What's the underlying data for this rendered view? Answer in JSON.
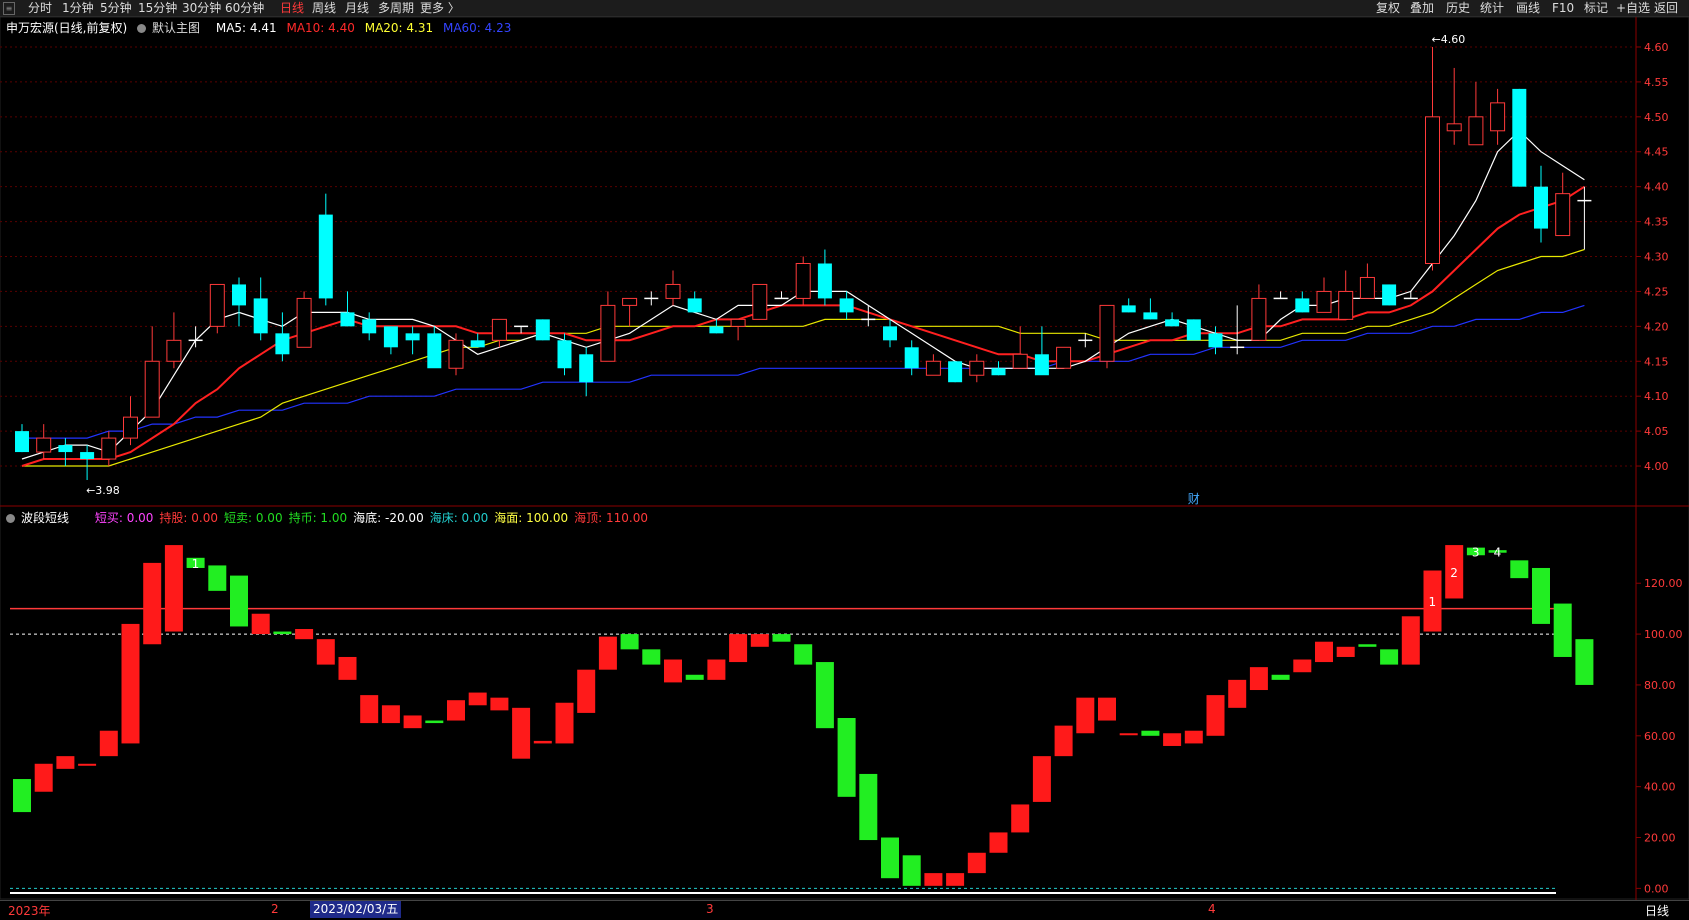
{
  "toolbar": {
    "left": [
      "分时",
      "1分钟",
      "5分钟",
      "15分钟",
      "30分钟",
      "60分钟",
      "日线",
      "周线",
      "月线",
      "多周期",
      "更多 〉"
    ],
    "active": "日线",
    "right": [
      "复权",
      "叠加",
      "历史",
      "统计",
      "画线",
      "F10",
      "标记",
      "+自选",
      "返回"
    ]
  },
  "main_legend": {
    "name": "申万宏源(日线,前复权)",
    "template": "默认主图",
    "ma5": "MA5: 4.41",
    "ma10": "MA10: 4.40",
    "ma20": "MA20: 4.31",
    "ma60": "MA60: 4.23"
  },
  "sub_legend": {
    "name": "波段短线",
    "items": [
      {
        "text": "短买: 0.00",
        "color": "#ff44ff"
      },
      {
        "text": "持股: 0.00",
        "color": "#ff3a3a"
      },
      {
        "text": "短卖: 0.00",
        "color": "#22dd22"
      },
      {
        "text": "持币: 1.00",
        "color": "#22dd22"
      },
      {
        "text": "海底: -20.00",
        "color": "#ffffff"
      },
      {
        "text": "海床: 0.00",
        "color": "#22cccc"
      },
      {
        "text": "海面: 100.00",
        "color": "#ffff44"
      },
      {
        "text": "海顶: 110.00",
        "color": "#ff3a3a"
      }
    ]
  },
  "bottom": {
    "year_label": "2023年",
    "m2": "2",
    "selected_date": "2023/02/03/五",
    "m3": "3",
    "m4": "4",
    "period_tag": "日线"
  },
  "colors": {
    "up": "#ff3a3a",
    "down": "#00ffff",
    "ma5": "#ffffff",
    "ma10": "#ff2020",
    "ma20": "#e8e800",
    "ma60": "#2233ff",
    "wave_up": "#ff1a1a",
    "wave_down": "#22ee22"
  },
  "chart_data": [
    {
      "type": "candlestick",
      "title": "申万宏源(日线,前复权)",
      "y_ticks": [
        4.0,
        4.05,
        4.1,
        4.15,
        4.2,
        4.25,
        4.3,
        4.35,
        4.4,
        4.45,
        4.5,
        4.55,
        4.6
      ],
      "ylim": [
        3.98,
        4.61
      ],
      "annotations": [
        {
          "text": "←3.98",
          "value": 3.98,
          "index": 3
        },
        {
          "text": "←4.60",
          "value": 4.6,
          "index": 65
        }
      ],
      "marker": {
        "text": "财",
        "index": 54
      },
      "ohlc": [
        [
          4.05,
          4.06,
          4.02,
          4.02
        ],
        [
          4.02,
          4.06,
          4.01,
          4.04
        ],
        [
          4.03,
          4.04,
          4.0,
          4.02
        ],
        [
          4.02,
          4.03,
          3.98,
          4.01
        ],
        [
          4.01,
          4.05,
          4.0,
          4.04
        ],
        [
          4.04,
          4.1,
          4.03,
          4.07
        ],
        [
          4.07,
          4.2,
          4.07,
          4.15
        ],
        [
          4.15,
          4.22,
          4.14,
          4.18
        ],
        [
          4.18,
          4.2,
          4.17,
          4.18
        ],
        [
          4.2,
          4.26,
          4.19,
          4.26
        ],
        [
          4.26,
          4.27,
          4.2,
          4.23
        ],
        [
          4.24,
          4.27,
          4.18,
          4.19
        ],
        [
          4.19,
          4.22,
          4.15,
          4.16
        ],
        [
          4.17,
          4.25,
          4.17,
          4.24
        ],
        [
          4.36,
          4.39,
          4.23,
          4.24
        ],
        [
          4.22,
          4.25,
          4.2,
          4.2
        ],
        [
          4.21,
          4.22,
          4.18,
          4.19
        ],
        [
          4.2,
          4.2,
          4.16,
          4.17
        ],
        [
          4.19,
          4.2,
          4.16,
          4.18
        ],
        [
          4.19,
          4.2,
          4.15,
          4.14
        ],
        [
          4.14,
          4.19,
          4.13,
          4.18
        ],
        [
          4.18,
          4.19,
          4.17,
          4.17
        ],
        [
          4.18,
          4.2,
          4.17,
          4.21
        ],
        [
          4.2,
          4.2,
          4.19,
          4.2
        ],
        [
          4.21,
          4.21,
          4.18,
          4.18
        ],
        [
          4.18,
          4.19,
          4.13,
          4.14
        ],
        [
          4.16,
          4.17,
          4.1,
          4.12
        ],
        [
          4.15,
          4.25,
          4.15,
          4.23
        ],
        [
          4.23,
          4.24,
          4.2,
          4.24
        ],
        [
          4.24,
          4.25,
          4.23,
          4.24
        ],
        [
          4.24,
          4.28,
          4.23,
          4.26
        ],
        [
          4.24,
          4.25,
          4.22,
          4.22
        ],
        [
          4.2,
          4.21,
          4.19,
          4.19
        ],
        [
          4.2,
          4.2,
          4.18,
          4.21
        ],
        [
          4.21,
          4.26,
          4.21,
          4.26
        ],
        [
          4.24,
          4.25,
          4.24,
          4.24
        ],
        [
          4.24,
          4.3,
          4.23,
          4.29
        ],
        [
          4.29,
          4.31,
          4.23,
          4.24
        ],
        [
          4.24,
          4.25,
          4.21,
          4.22
        ],
        [
          4.21,
          4.23,
          4.2,
          4.21
        ],
        [
          4.2,
          4.21,
          4.17,
          4.18
        ],
        [
          4.17,
          4.18,
          4.13,
          4.14
        ],
        [
          4.13,
          4.16,
          4.13,
          4.15
        ],
        [
          4.15,
          4.15,
          4.12,
          4.12
        ],
        [
          4.13,
          4.16,
          4.12,
          4.15
        ],
        [
          4.14,
          4.15,
          4.13,
          4.13
        ],
        [
          4.14,
          4.2,
          4.14,
          4.16
        ],
        [
          4.16,
          4.2,
          4.14,
          4.13
        ],
        [
          4.14,
          4.17,
          4.14,
          4.17
        ],
        [
          4.18,
          4.19,
          4.17,
          4.18
        ],
        [
          4.15,
          4.23,
          4.14,
          4.23
        ],
        [
          4.23,
          4.24,
          4.22,
          4.22
        ],
        [
          4.22,
          4.24,
          4.21,
          4.21
        ],
        [
          4.21,
          4.22,
          4.2,
          4.2
        ],
        [
          4.21,
          4.21,
          4.18,
          4.18
        ],
        [
          4.19,
          4.2,
          4.16,
          4.17
        ],
        [
          4.17,
          4.23,
          4.16,
          4.17
        ],
        [
          4.18,
          4.26,
          4.18,
          4.24
        ],
        [
          4.24,
          4.25,
          4.24,
          4.24
        ],
        [
          4.24,
          4.25,
          4.22,
          4.22
        ],
        [
          4.22,
          4.27,
          4.22,
          4.25
        ],
        [
          4.21,
          4.28,
          4.21,
          4.25
        ],
        [
          4.24,
          4.29,
          4.24,
          4.27
        ],
        [
          4.26,
          4.26,
          4.23,
          4.23
        ],
        [
          4.24,
          4.25,
          4.24,
          4.24
        ],
        [
          4.29,
          4.6,
          4.28,
          4.5
        ],
        [
          4.48,
          4.57,
          4.46,
          4.49
        ],
        [
          4.46,
          4.55,
          4.46,
          4.5
        ],
        [
          4.48,
          4.54,
          4.46,
          4.52
        ],
        [
          4.54,
          4.54,
          4.4,
          4.4
        ],
        [
          4.4,
          4.43,
          4.32,
          4.34
        ],
        [
          4.33,
          4.42,
          4.33,
          4.39
        ],
        [
          4.38,
          4.4,
          4.31,
          4.38
        ]
      ],
      "ma5": [
        4.01,
        4.02,
        4.03,
        4.03,
        4.02,
        4.05,
        4.08,
        4.13,
        4.18,
        4.21,
        4.22,
        4.21,
        4.2,
        4.22,
        4.22,
        4.22,
        4.21,
        4.21,
        4.21,
        4.2,
        4.18,
        4.16,
        4.17,
        4.18,
        4.19,
        4.18,
        4.17,
        4.18,
        4.19,
        4.21,
        4.23,
        4.22,
        4.21,
        4.23,
        4.23,
        4.23,
        4.25,
        4.25,
        4.25,
        4.23,
        4.21,
        4.19,
        4.17,
        4.15,
        4.14,
        4.14,
        4.14,
        4.14,
        4.14,
        4.15,
        4.17,
        4.19,
        4.2,
        4.21,
        4.2,
        4.19,
        4.18,
        4.18,
        4.21,
        4.23,
        4.23,
        4.24,
        4.24,
        4.24,
        4.25,
        4.29,
        4.33,
        4.38,
        4.45,
        4.48,
        4.45,
        4.43,
        4.41
      ],
      "ma10": [
        4.0,
        4.01,
        4.01,
        4.01,
        4.01,
        4.02,
        4.04,
        4.06,
        4.09,
        4.11,
        4.14,
        4.16,
        4.18,
        4.19,
        4.2,
        4.21,
        4.2,
        4.2,
        4.2,
        4.2,
        4.2,
        4.19,
        4.19,
        4.19,
        4.19,
        4.19,
        4.18,
        4.18,
        4.18,
        4.19,
        4.2,
        4.2,
        4.21,
        4.21,
        4.22,
        4.23,
        4.23,
        4.23,
        4.23,
        4.22,
        4.21,
        4.2,
        4.19,
        4.18,
        4.17,
        4.16,
        4.16,
        4.15,
        4.15,
        4.15,
        4.16,
        4.17,
        4.18,
        4.18,
        4.19,
        4.19,
        4.19,
        4.2,
        4.2,
        4.21,
        4.21,
        4.21,
        4.22,
        4.22,
        4.23,
        4.25,
        4.28,
        4.31,
        4.34,
        4.36,
        4.37,
        4.38,
        4.4
      ],
      "ma20": [
        4.0,
        4.0,
        4.0,
        4.0,
        4.0,
        4.01,
        4.02,
        4.03,
        4.04,
        4.05,
        4.06,
        4.07,
        4.09,
        4.1,
        4.11,
        4.12,
        4.13,
        4.14,
        4.15,
        4.16,
        4.17,
        4.17,
        4.18,
        4.18,
        4.19,
        4.19,
        4.19,
        4.2,
        4.2,
        4.2,
        4.2,
        4.2,
        4.2,
        4.2,
        4.2,
        4.2,
        4.2,
        4.21,
        4.21,
        4.21,
        4.21,
        4.2,
        4.2,
        4.2,
        4.2,
        4.2,
        4.19,
        4.19,
        4.19,
        4.19,
        4.18,
        4.18,
        4.18,
        4.18,
        4.18,
        4.18,
        4.18,
        4.18,
        4.18,
        4.19,
        4.19,
        4.19,
        4.2,
        4.2,
        4.21,
        4.22,
        4.24,
        4.26,
        4.28,
        4.29,
        4.3,
        4.3,
        4.31
      ],
      "ma60": [
        4.04,
        4.04,
        4.04,
        4.04,
        4.05,
        4.05,
        4.06,
        4.06,
        4.07,
        4.07,
        4.08,
        4.08,
        4.08,
        4.09,
        4.09,
        4.09,
        4.1,
        4.1,
        4.1,
        4.1,
        4.11,
        4.11,
        4.11,
        4.11,
        4.12,
        4.12,
        4.12,
        4.12,
        4.12,
        4.13,
        4.13,
        4.13,
        4.13,
        4.13,
        4.14,
        4.14,
        4.14,
        4.14,
        4.14,
        4.14,
        4.14,
        4.14,
        4.14,
        4.14,
        4.14,
        4.14,
        4.14,
        4.14,
        4.15,
        4.15,
        4.15,
        4.15,
        4.16,
        4.16,
        4.16,
        4.17,
        4.17,
        4.17,
        4.17,
        4.18,
        4.18,
        4.18,
        4.19,
        4.19,
        4.19,
        4.2,
        4.2,
        4.21,
        4.21,
        4.21,
        4.22,
        4.22,
        4.23
      ]
    },
    {
      "type": "bar",
      "title": "波段短线",
      "y_ticks": [
        0,
        20,
        40,
        60,
        80,
        100,
        120
      ],
      "ylim": [
        -3,
        137
      ],
      "ref_lines": [
        {
          "value": 110,
          "style": "solid",
          "color": "#ff3a3a"
        },
        {
          "value": 100,
          "style": "dashed",
          "color": "#ffffff"
        },
        {
          "value": 0,
          "style": "dashed",
          "color": "#22cccc"
        }
      ],
      "bars": [
        [
          43,
          30
        ],
        [
          38,
          49
        ],
        [
          47,
          52
        ],
        [
          49,
          49
        ],
        [
          52,
          62
        ],
        [
          57,
          104
        ],
        [
          96,
          128
        ],
        [
          101,
          135
        ],
        [
          130,
          126
        ],
        [
          127,
          117
        ],
        [
          123,
          103
        ],
        [
          100,
          108
        ],
        [
          101,
          100
        ],
        [
          98,
          102
        ],
        [
          88,
          98
        ],
        [
          82,
          91
        ],
        [
          65,
          76
        ],
        [
          65,
          72
        ],
        [
          63,
          68
        ],
        [
          66,
          65
        ],
        [
          66,
          74
        ],
        [
          72,
          77
        ],
        [
          70,
          75
        ],
        [
          51,
          71
        ],
        [
          57,
          58
        ],
        [
          57,
          73
        ],
        [
          69,
          86
        ],
        [
          86,
          99
        ],
        [
          100,
          94
        ],
        [
          94,
          88
        ],
        [
          81,
          90
        ],
        [
          84,
          82
        ],
        [
          82,
          90
        ],
        [
          89,
          100
        ],
        [
          95,
          100
        ],
        [
          100,
          97
        ],
        [
          96,
          88
        ],
        [
          89,
          63
        ],
        [
          67,
          36
        ],
        [
          45,
          19
        ],
        [
          20,
          4
        ],
        [
          13,
          1
        ],
        [
          1,
          6
        ],
        [
          1,
          6
        ],
        [
          6,
          14
        ],
        [
          14,
          22
        ],
        [
          22,
          33
        ],
        [
          34,
          52
        ],
        [
          52,
          64
        ],
        [
          61,
          75
        ],
        [
          66,
          75
        ],
        [
          61,
          61
        ],
        [
          62,
          60
        ],
        [
          56,
          61
        ],
        [
          57,
          62
        ],
        [
          60,
          76
        ],
        [
          71,
          82
        ],
        [
          78,
          87
        ],
        [
          84,
          82
        ],
        [
          85,
          90
        ],
        [
          89,
          97
        ],
        [
          91,
          95
        ],
        [
          96,
          95
        ],
        [
          94,
          88
        ],
        [
          88,
          107
        ],
        [
          101,
          125
        ],
        [
          114,
          135
        ],
        [
          134,
          131
        ],
        [
          133,
          132
        ],
        [
          129,
          122
        ],
        [
          126,
          104
        ],
        [
          112,
          91
        ],
        [
          98,
          80
        ]
      ],
      "labels": [
        {
          "index": 8,
          "text": "1"
        },
        {
          "index": 65,
          "text": "1"
        },
        {
          "index": 66,
          "text": "2"
        },
        {
          "index": 67,
          "text": "3"
        },
        {
          "index": 68,
          "text": "4"
        }
      ]
    }
  ]
}
